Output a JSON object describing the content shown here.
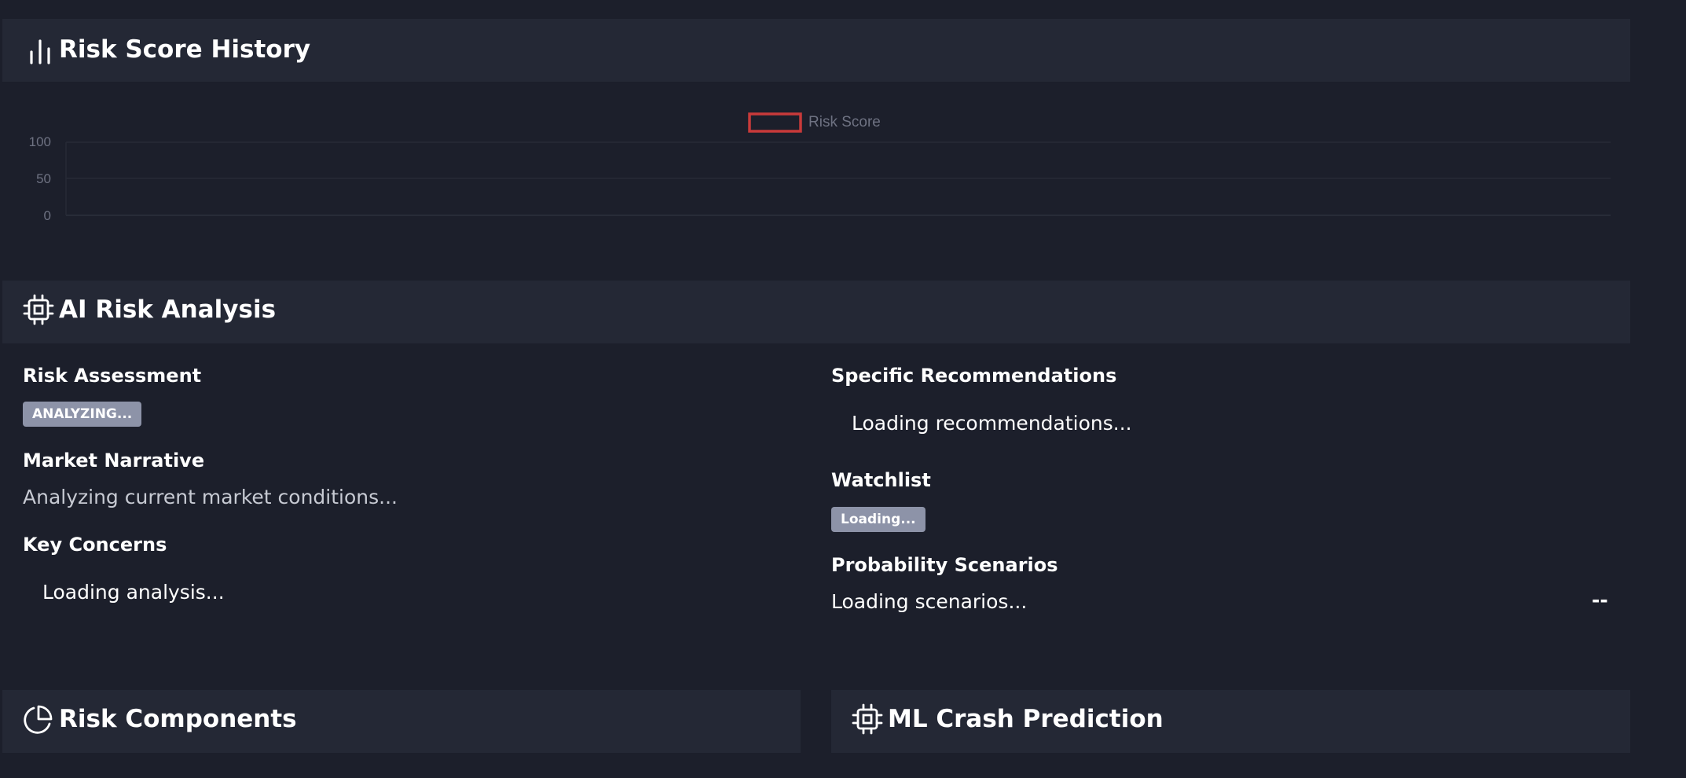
{
  "risk_history": {
    "title": "Risk Score History",
    "icon": "bar-chart-icon"
  },
  "chart_data": {
    "type": "line",
    "series": [
      {
        "name": "Risk Score",
        "values": []
      }
    ],
    "y_ticks": [
      "100",
      "50",
      "0"
    ],
    "ylim": [
      0,
      100
    ],
    "legend_position": "top-center",
    "grid": true,
    "colors": {
      "series": "#c83a3a",
      "grid": "#262a36",
      "ticks": "#6e7282"
    }
  },
  "ai_analysis": {
    "title": "AI Risk Analysis",
    "icon": "cpu-icon",
    "risk_assessment": {
      "label": "Risk Assessment",
      "badge": "ANALYZING..."
    },
    "market_narrative": {
      "label": "Market Narrative",
      "text": "Analyzing current market conditions..."
    },
    "key_concerns": {
      "label": "Key Concerns",
      "text": "Loading analysis..."
    },
    "recommendations": {
      "label": "Specific Recommendations",
      "text": "Loading recommendations..."
    },
    "watchlist": {
      "label": "Watchlist",
      "badge": "Loading..."
    },
    "scenarios": {
      "label": "Probability Scenarios",
      "text": "Loading scenarios...",
      "value": "--"
    }
  },
  "risk_components": {
    "title": "Risk Components",
    "icon": "pie-chart-icon"
  },
  "ml_crash": {
    "title": "ML Crash Prediction",
    "icon": "cpu-icon"
  },
  "colors": {
    "background": "#1c1f2b",
    "panel_header": "#242835",
    "badge": "#8d93a8"
  }
}
